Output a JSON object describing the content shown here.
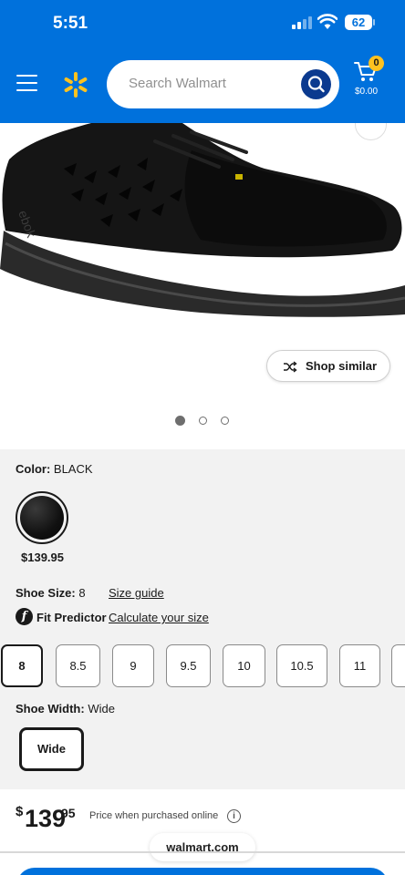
{
  "status_bar": {
    "time": "5:51",
    "battery": "62"
  },
  "header": {
    "search_placeholder": "Search Walmart",
    "cart_count": "0",
    "cart_total": "$0.00",
    "brand_color": "#0071dc"
  },
  "product_image": {
    "shop_similar_label": "Shop similar",
    "carousel_dots": 3,
    "active_dot": 0
  },
  "color": {
    "label": "Color:",
    "value": "BLACK",
    "swatch_price": "$139.95"
  },
  "shoe_size": {
    "label": "Shoe Size:",
    "value": "8",
    "size_guide_link": "Size guide",
    "fit_predictor_label": "Fit Predictor",
    "calculate_link": "Calculate your size",
    "options": [
      "8",
      "8.5",
      "9",
      "9.5",
      "10",
      "10.5",
      "11"
    ],
    "selected": "8"
  },
  "shoe_width": {
    "label": "Shoe Width:",
    "value": "Wide",
    "options": [
      "Wide"
    ]
  },
  "price": {
    "currency": "$",
    "whole": "139",
    "cents": "95",
    "note": "Price when purchased online",
    "info_icon": "i"
  },
  "footer": {
    "domain": "walmart.com"
  }
}
